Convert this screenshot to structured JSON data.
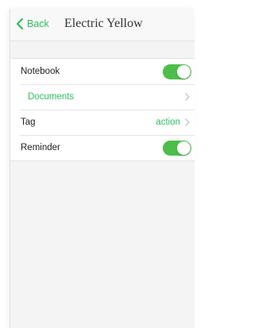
{
  "nav": {
    "back_label": "Back",
    "title": "Electric Yellow"
  },
  "rows": [
    {
      "label": "Notebook",
      "control": "toggle",
      "toggle_on": true
    },
    {
      "label": "Documents",
      "control": "chevron"
    },
    {
      "label": "Tag",
      "value": "action",
      "control": "chevron"
    },
    {
      "label": "Reminder",
      "control": "toggle",
      "toggle_on": true
    }
  ],
  "colors": {
    "accent": "#2dbe60",
    "toggle_on": "#4cbf4b"
  },
  "icons": {
    "back": "chevron-left-icon",
    "disclosure": "chevron-right-icon"
  }
}
